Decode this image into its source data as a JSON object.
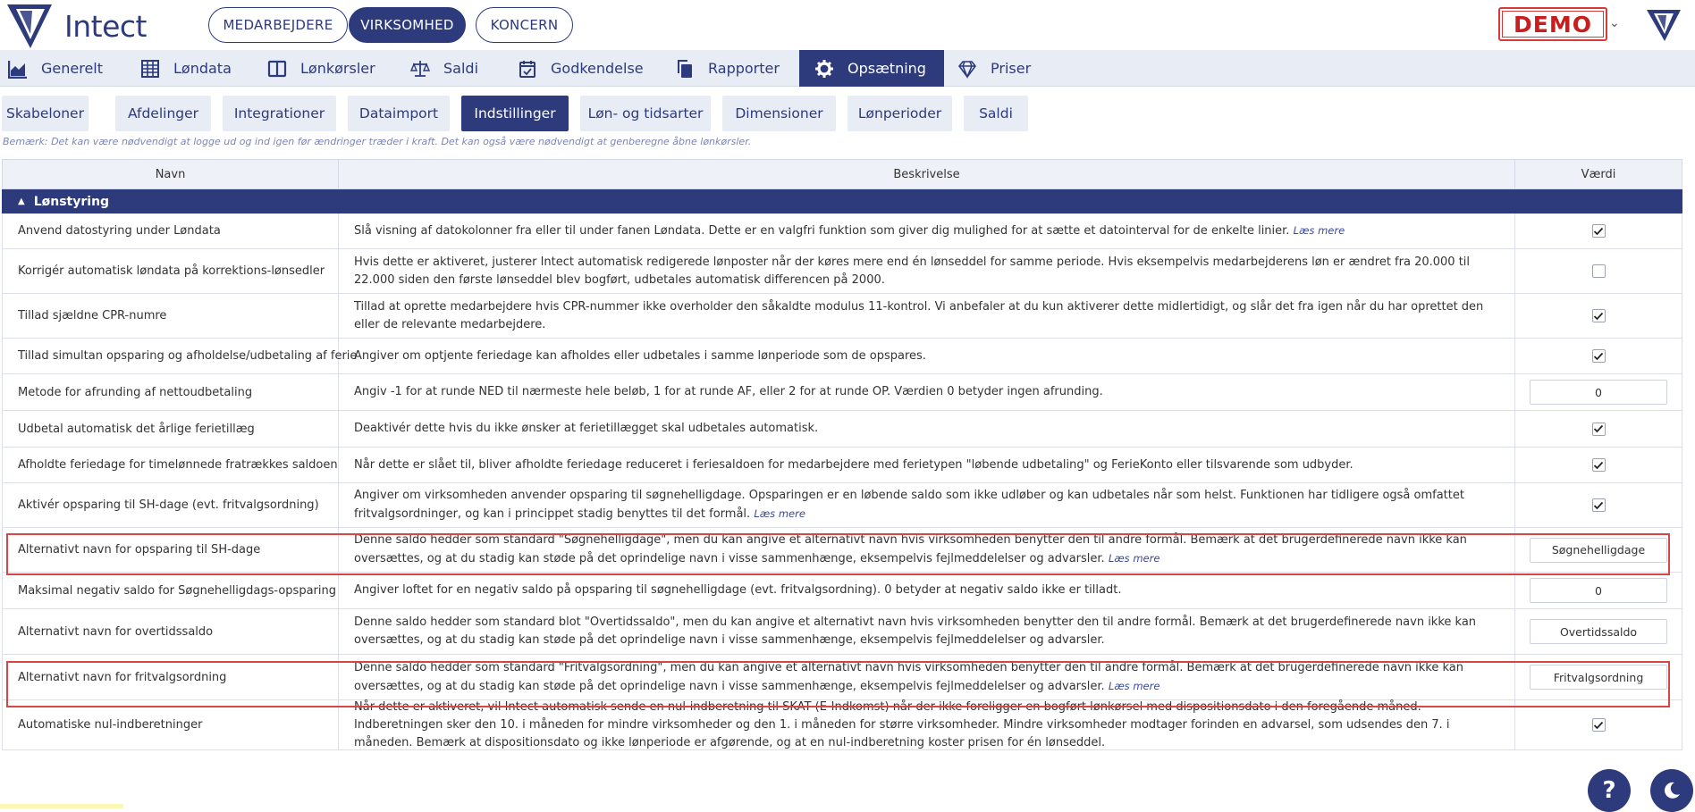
{
  "brand": {
    "name": "Intect"
  },
  "header": {
    "pills": [
      "MEDARBEJDERE",
      "VIRKSOMHED",
      "KONCERN"
    ],
    "active_pill": "VIRKSOMHED",
    "demo_label": "DEMO"
  },
  "main_nav": [
    {
      "label": "Generelt",
      "icon": "chart-area-icon"
    },
    {
      "label": "Løndata",
      "icon": "table-grid-icon"
    },
    {
      "label": "Lønkørsler",
      "icon": "columns-icon"
    },
    {
      "label": "Saldi",
      "icon": "scale-icon"
    },
    {
      "label": "Godkendelse",
      "icon": "calendar-check-icon"
    },
    {
      "label": "Rapporter",
      "icon": "copy-icon"
    },
    {
      "label": "Opsætning",
      "icon": "gear-icon"
    },
    {
      "label": "Priser",
      "icon": "diamond-icon"
    }
  ],
  "main_nav_active": "Opsætning",
  "sub_nav": [
    "Skabeloner",
    "Afdelinger",
    "Integrationer",
    "Dataimport",
    "Indstillinger",
    "Løn- og tidsarter",
    "Dimensioner",
    "Lønperioder",
    "Saldi"
  ],
  "sub_nav_active": "Indstillinger",
  "note": "Bemærk: Det kan være nødvendigt at logge ud og ind igen før ændringer træder i kraft. Det kan også være nødvendigt at genberegne åbne lønkørsler.",
  "table": {
    "headers": {
      "name": "Navn",
      "description": "Beskrivelse",
      "value": "Værdi"
    },
    "group": "Lønstyring",
    "read_more": "Læs mere",
    "rows": [
      {
        "name": "Anvend datostyring under Løndata",
        "desc": "Slå visning af datokolonner fra eller til under fanen Løndata. Dette er en valgfri funktion som giver dig mulighed for at sætte et datointerval for de enkelte linier.",
        "read_more": true,
        "type": "checkbox",
        "checked": true
      },
      {
        "name": "Korrigér automatisk løndata på korrektions-lønsedler",
        "desc": "Hvis dette er aktiveret, justerer Intect automatisk redigerede lønposter når der køres mere end én lønseddel for samme periode. Hvis eksempelvis medarbejderens løn er ændret fra 20.000 til 22.000 siden den første lønseddel blev bogført, udbetales automatisk differencen på 2000.",
        "read_more": false,
        "type": "checkbox",
        "checked": false
      },
      {
        "name": "Tillad sjældne CPR-numre",
        "desc": "Tillad at oprette medarbejdere hvis CPR-nummer ikke overholder den såkaldte modulus 11-kontrol. Vi anbefaler at du kun aktiverer dette midlertidigt, og slår det fra igen når du har oprettet den eller de relevante medarbejdere.",
        "read_more": false,
        "type": "checkbox",
        "checked": true
      },
      {
        "name": "Tillad simultan opsparing og afholdelse/udbetaling af ferie",
        "desc": "Angiver om optjente feriedage kan afholdes eller udbetales i samme lønperiode som de opspares.",
        "read_more": false,
        "type": "checkbox",
        "checked": true
      },
      {
        "name": "Metode for afrunding af nettoudbetaling",
        "desc": "Angiv -1 for at runde NED til nærmeste hele beløb, 1 for at runde AF, eller 2 for at runde OP. Værdien 0 betyder ingen afrunding.",
        "read_more": false,
        "type": "input",
        "value": "0"
      },
      {
        "name": "Udbetal automatisk det årlige ferietillæg",
        "desc": "Deaktivér dette hvis du ikke ønsker at ferietillægget skal udbetales automatisk.",
        "read_more": false,
        "type": "checkbox",
        "checked": true
      },
      {
        "name": "Afholdte feriedage for timelønnede fratrækkes saldoen",
        "desc": "Når dette er slået til, bliver afholdte feriedage reduceret i feriesaldoen for medarbejdere med ferietypen \"løbende udbetaling\" og FerieKonto eller tilsvarende som udbyder.",
        "read_more": false,
        "type": "checkbox",
        "checked": true
      },
      {
        "name": "Aktivér opsparing til SH-dage (evt. fritvalgsordning)",
        "desc": "Angiver om virksomheden anvender opsparing til søgnehelligdage. Opsparingen er en løbende saldo som ikke udløber og kan udbetales når som helst. Funktionen har tidligere også omfattet fritvalgsordninger, og kan i princippet stadig benyttes til det formål.",
        "read_more": true,
        "type": "checkbox",
        "checked": true
      },
      {
        "name": "Alternativt navn for opsparing til SH-dage",
        "desc": "Denne saldo hedder som standard \"Søgnehelligdage\", men du kan angive et alternativt navn hvis virksomheden benytter den til andre formål. Bemærk at det brugerdefinerede navn ikke kan oversættes, og at du stadig kan støde på det oprindelige navn i visse sammenhænge, eksempelvis fejlmeddelelser og advarsler.",
        "read_more": true,
        "type": "input",
        "value": "Søgnehelligdage"
      },
      {
        "name": "Maksimal negativ saldo for Søgnehelligdags-opsparing",
        "desc": "Angiver loftet for en negativ saldo på opsparing til søgnehelligdage (evt. fritvalgsordning). 0 betyder at negativ saldo ikke er tilladt.",
        "read_more": false,
        "type": "input",
        "value": "0"
      },
      {
        "name": "Alternativt navn for overtidssaldo",
        "desc": "Denne saldo hedder som standard blot \"Overtidssaldo\", men du kan angive et alternativt navn hvis virksomheden benytter den til andre formål. Bemærk at det brugerdefinerede navn ikke kan oversættes, og at du stadig kan støde på det oprindelige navn i visse sammenhænge, eksempelvis fejlmeddelelser og advarsler.",
        "read_more": false,
        "type": "input",
        "value": "Overtidssaldo"
      },
      {
        "name": "Alternativt navn for fritvalgsordning",
        "desc": "Denne saldo hedder som standard \"Fritvalgsordning\", men du kan angive et alternativt navn hvis virksomheden benytter den til andre formål. Bemærk at det brugerdefinerede navn ikke kan oversættes, og at du stadig kan støde på det oprindelige navn i visse sammenhænge, eksempelvis fejlmeddelelser og advarsler.",
        "read_more": true,
        "type": "input",
        "value": "Fritvalgsordning"
      },
      {
        "name": "Automatiske nul-indberetninger",
        "desc": "Når dette er aktiveret, vil Intect automatisk sende en nul-indberetning til SKAT (E-Indkomst) når der ikke foreligger en bogført lønkørsel med dispositionsdato i den foregående måned. Indberetningen sker den 10. i måneden for mindre virksomheder og den 1. i måneden for større virksomheder. Mindre virksomheder modtager forinden en advarsel, som udsendes den 7. i måneden. Bemærk at dispositionsdato og ikke lønperiode er afgørende, og at en nul-indberetning koster prisen for én lønseddel.",
        "read_more": false,
        "type": "checkbox",
        "checked": true
      }
    ]
  },
  "help_label": "?",
  "colors": {
    "primary": "#2d3a7c",
    "nav_bg": "#e8ecf4",
    "highlight": "#d84545",
    "demo": "#c81e1e"
  }
}
